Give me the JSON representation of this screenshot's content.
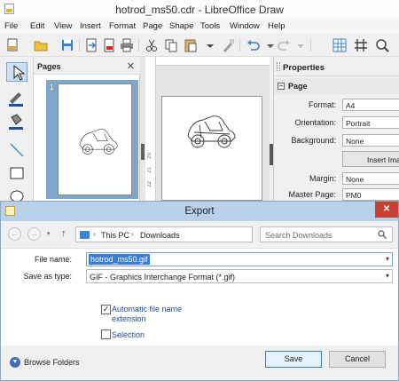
{
  "window": {
    "title": "hotrod_ms50.cdr - LibreOffice Draw"
  },
  "menu": [
    "File",
    "Edit",
    "View",
    "Insert",
    "Format",
    "Page",
    "Shape",
    "Tools",
    "Window",
    "Help"
  ],
  "pages_pane": {
    "title": "Pages",
    "page_number": "1"
  },
  "properties": {
    "title": "Properties",
    "section": "Page",
    "format_label": "Format:",
    "format_value": "A4",
    "orientation_label": "Orientation:",
    "orientation_value": "Portrait",
    "background_label": "Background:",
    "background_value": "None",
    "insert_image_label": "Insert Ima",
    "margin_label": "Margin:",
    "margin_value": "None",
    "master_label": "Master Page:",
    "master_value": "PM0"
  },
  "ruler": [
    "20",
    "21",
    "22"
  ],
  "dialog": {
    "title": "Export",
    "close": "✕",
    "path": [
      "This PC",
      "Downloads"
    ],
    "search_placeholder": "Search Downloads",
    "filename_label": "File name:",
    "filename_value": "hotrod_ms50.gif",
    "filetype_label": "Save as type:",
    "filetype_value": "GIF - Graphics Interchange Format (*.gif)",
    "auto_ext_label": "Automatic file name extension",
    "auto_ext_checked": true,
    "selection_label": "Selection",
    "selection_checked": false,
    "browse_folders": "Browse Folders",
    "save": "Save",
    "cancel": "Cancel"
  },
  "colors": {
    "accent": "#3a7ed1",
    "dialog_titlebar": "#b8d0ea",
    "close_button": "#c84031",
    "page_selection": "#7ea6c9"
  },
  "icons": [
    "new-document-icon",
    "open-folder-icon",
    "save-icon",
    "export-icon",
    "pdf-icon",
    "print-icon",
    "cut-icon",
    "copy-icon",
    "paste-icon",
    "clone-formatting-icon",
    "undo-icon",
    "redo-icon",
    "grid-icon",
    "snap-grid-icon",
    "zoom-icon",
    "select-arrow-icon",
    "line-color-icon",
    "fill-color-icon",
    "line-icon",
    "rectangle-icon",
    "ellipse-icon",
    "car-drawing-icon",
    "search-icon"
  ]
}
